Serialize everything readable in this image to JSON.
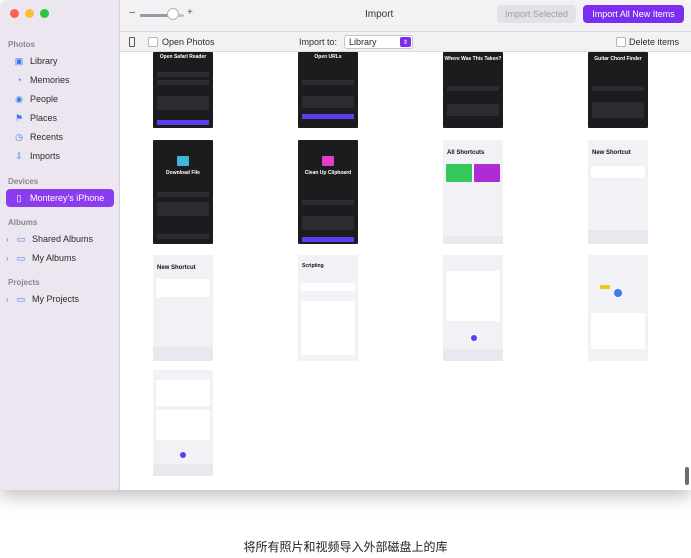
{
  "window": {
    "title": "Import"
  },
  "toolbar": {
    "import_selected": "Import Selected",
    "import_all": "Import All New Items",
    "open_photos": "Open Photos",
    "import_to_label": "Import to:",
    "import_to_value": "Library",
    "delete_items": "Delete items",
    "zoom_minus": "−",
    "zoom_plus": "+",
    "zoom_level": 0.75
  },
  "sidebar": {
    "photos_header": "Photos",
    "photos_items": [
      {
        "label": "Library",
        "icon": "library-icon"
      },
      {
        "label": "Memories",
        "icon": "memories-icon"
      },
      {
        "label": "People",
        "icon": "people-icon"
      },
      {
        "label": "Places",
        "icon": "places-icon"
      },
      {
        "label": "Recents",
        "icon": "recents-icon"
      },
      {
        "label": "Imports",
        "icon": "imports-icon"
      }
    ],
    "devices_header": "Devices",
    "device": "Monterey's iPhone",
    "albums_header": "Albums",
    "albums_items": [
      "Shared Albums",
      "My Albums"
    ],
    "projects_header": "Projects",
    "projects_items": [
      "My Projects"
    ]
  },
  "thumbnails": {
    "row1": [
      "Open Safari Reader",
      "Open URLs",
      "Where Was This Taken?",
      "Guitar Chord Finder"
    ],
    "row2": [
      "Download File",
      "Clean Up Clipboard",
      "All Shortcuts",
      "New Shortcut"
    ],
    "row3": [
      "New Shortcut",
      "Scripting",
      "",
      ""
    ],
    "row4": [
      ""
    ]
  },
  "caption": "将所有照片和视频导入外部磁盘上的库"
}
